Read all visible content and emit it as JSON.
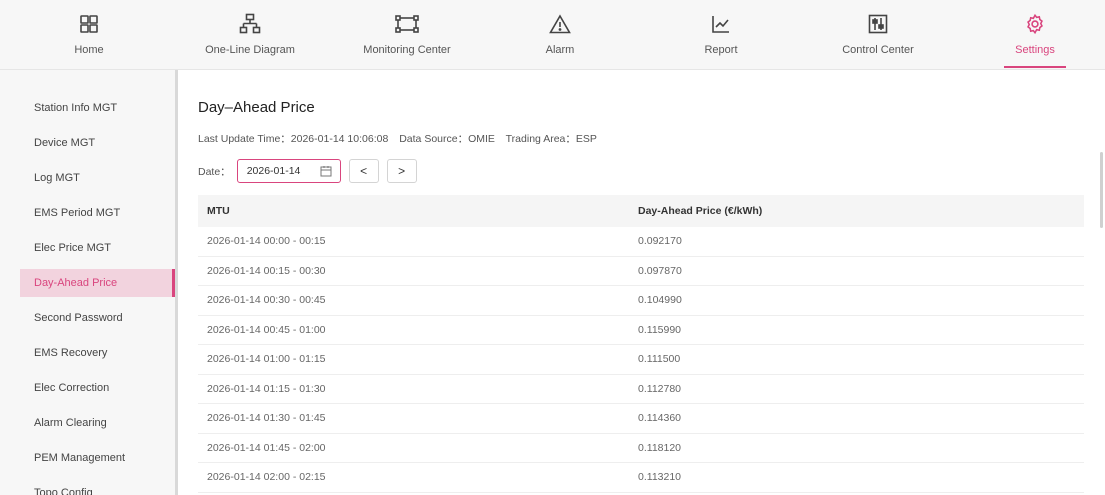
{
  "nav": {
    "items": [
      {
        "label": "Home",
        "icon": "grid-icon",
        "active": false
      },
      {
        "label": "One-Line Diagram",
        "icon": "hierarchy-icon",
        "active": false
      },
      {
        "label": "Monitoring Center",
        "icon": "monitor-frame-icon",
        "active": false
      },
      {
        "label": "Alarm",
        "icon": "warning-triangle-icon",
        "active": false
      },
      {
        "label": "Report",
        "icon": "line-chart-icon",
        "active": false
      },
      {
        "label": "Control Center",
        "icon": "sliders-icon",
        "active": false
      },
      {
        "label": "Settings",
        "icon": "gear-icon",
        "active": true
      }
    ]
  },
  "sidebar": {
    "items": [
      {
        "label": "Station Info MGT",
        "active": false
      },
      {
        "label": "Device MGT",
        "active": false
      },
      {
        "label": "Log MGT",
        "active": false
      },
      {
        "label": "EMS Period MGT",
        "active": false
      },
      {
        "label": "Elec Price MGT",
        "active": false
      },
      {
        "label": "Day-Ahead Price",
        "active": true
      },
      {
        "label": "Second Password",
        "active": false
      },
      {
        "label": "EMS Recovery",
        "active": false
      },
      {
        "label": "Elec Correction",
        "active": false
      },
      {
        "label": "Alarm Clearing",
        "active": false
      },
      {
        "label": "PEM Management",
        "active": false
      },
      {
        "label": "Topo Config",
        "active": false
      }
    ]
  },
  "main": {
    "title": "Day–Ahead Price",
    "last_update": "Last Update Time：2026-01-14 10:06:08",
    "data_source": "Data Source：OMIE",
    "trading_area": "Trading Area：ESP",
    "date_label": "Date：",
    "date_value": "2026-01-14",
    "prev_glyph": "<",
    "next_glyph": ">"
  },
  "table": {
    "headers": [
      "MTU",
      "Day-Ahead Price (€/kWh)"
    ],
    "rows": [
      [
        "2026-01-14 00:00 - 00:15",
        "0.092170"
      ],
      [
        "2026-01-14 00:15 - 00:30",
        "0.097870"
      ],
      [
        "2026-01-14 00:30 - 00:45",
        "0.104990"
      ],
      [
        "2026-01-14 00:45 - 01:00",
        "0.115990"
      ],
      [
        "2026-01-14 01:00 - 01:15",
        "0.111500"
      ],
      [
        "2026-01-14 01:15 - 01:30",
        "0.112780"
      ],
      [
        "2026-01-14 01:30 - 01:45",
        "0.114360"
      ],
      [
        "2026-01-14 01:45 - 02:00",
        "0.118120"
      ],
      [
        "2026-01-14 02:00 - 02:15",
        "0.113210"
      ]
    ]
  },
  "colors": {
    "accent": "#d9457e",
    "active_bg": "#f2d3de",
    "nav_bg": "#f7f7f7"
  }
}
